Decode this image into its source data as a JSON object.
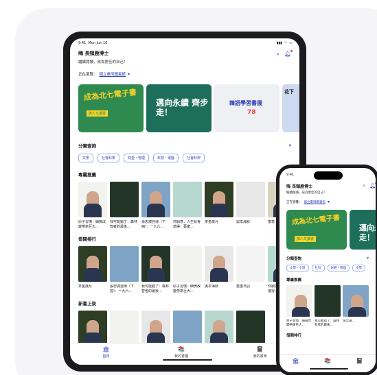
{
  "ipad": {
    "status": {
      "time": "9:41",
      "date": "Mon Jun 10"
    },
    "header": {
      "greeting": "嗨 長頸鹿博士",
      "subtitle": "繼續閱讀，成為更佳的自己！"
    },
    "browsing": {
      "label": "正在瀏覽：",
      "library": "國立臺灣圖書館"
    },
    "banners": [
      {
        "title": "成為北七電子書",
        "subtitle": "誰人又讀書",
        "color": "#2f8a50"
      },
      {
        "title": "邁向永續 齊步走！",
        "color": "#1d6f5c"
      },
      {
        "title": "韓語學習書展",
        "highlight": "78",
        "color": "#eef0f3"
      },
      {
        "title": "花下",
        "color": "#cdd9ee"
      }
    ],
    "categories": {
      "title": "分類查詢",
      "tags": [
        "文學",
        "社會科學",
        "財金・管理",
        "科技・電腦",
        "社會科學"
      ]
    },
    "recommended": {
      "title": "專屬推薦",
      "books": [
        {
          "title": "原子習慣：細微改變帶來巨大...",
          "cover_color": "#f2f2ee",
          "ink": "#333333"
        },
        {
          "title": "我可能錯了：森林智者的最後...",
          "cover_color": "#223526",
          "ink": "#e9dfb0"
        },
        {
          "title": "張忠謀自傳（下冊）：一九六...",
          "cover_color": "#7fa4c6",
          "ink": "#ffffff"
        },
        {
          "title": "你願意，人生就會值得：蔡康...",
          "cover_color": "#b7d8cf",
          "ink": "#2b4a44"
        },
        {
          "title": "茶金歲月",
          "cover_color": "#2d3e25",
          "ink": "#e5c65b"
        },
        {
          "title": "奧本海默",
          "cover_color": "#e7e7e7",
          "ink": "#333333"
        },
        {
          "title": "蜜笔",
          "cover_color": "#d8d2c0",
          "ink": "#333333"
        }
      ]
    },
    "ranking": {
      "title": "借閱排行",
      "books": [
        {
          "title": "茶金歲月",
          "cover_color": "#2d3e25",
          "ink": "#e5c65b"
        },
        {
          "title": "張忠謀自傳（下冊）：一九六...",
          "cover_color": "#7fa4c6",
          "ink": "#ffffff"
        },
        {
          "title": "我可能錯了：森林智者的最後...",
          "cover_color": "#223526",
          "ink": "#e9dfb0"
        },
        {
          "title": "原子習慣：細微改變帶來巨大...",
          "cover_color": "#f2f2ee",
          "ink": "#333333"
        },
        {
          "title": "奧本海默",
          "cover_color": "#e7e7e7",
          "ink": "#333333"
        },
        {
          "title": "蜜笛日記",
          "cover_color": "#f4f4f4",
          "ink": "#333333"
        },
        {
          "title": "你願意，人生就會值得：蔡康...",
          "cover_color": "#b7d8cf",
          "ink": "#2b4a44"
        }
      ]
    },
    "new_arrivals": {
      "title": "新書上架",
      "books": [
        {
          "title": "",
          "cover_color": "#2d3e25",
          "ink": "#e5c65b"
        },
        {
          "title": "",
          "cover_color": "#f2f2ee",
          "ink": "#333333"
        },
        {
          "title": "",
          "cover_color": "#e7e7e7",
          "ink": "#333333"
        },
        {
          "title": "",
          "cover_color": "#7fa4c6",
          "ink": "#ffffff"
        },
        {
          "title": "",
          "cover_color": "#b7d8cf",
          "ink": "#2b4a44"
        },
        {
          "title": "",
          "cover_color": "#223526",
          "ink": "#e9dfb0"
        }
      ]
    },
    "tabs": [
      {
        "label": "首頁",
        "icon": "home-icon",
        "glyph": "🏛",
        "active": true
      },
      {
        "label": "我的書櫃",
        "icon": "bookshelf-icon",
        "glyph": "📚",
        "active": false
      },
      {
        "label": "我的書單",
        "icon": "booklist-icon",
        "glyph": "📓",
        "active": false
      }
    ]
  },
  "iphone": {
    "status": {
      "time": "9:41"
    },
    "header": {
      "greeting": "嗨 長頸鹿博士",
      "subtitle": "繼續閱讀，成為更佳的自己！"
    },
    "browsing": {
      "label": "正在瀏覽：",
      "library": "國立臺灣圖書館"
    },
    "categories": {
      "title": "分類查詢",
      "tags": [
        "文學・小說",
        "社科",
        "財經・管理",
        "文學"
      ]
    },
    "recommended": {
      "title": "專屬推薦",
      "books": [
        {
          "title": "原子習慣：細微改變帶來巨大...",
          "cover_color": "#f2f2ee",
          "ink": "#333333"
        },
        {
          "title": "我可能錯了：森林智者的最後...",
          "cover_color": "#223526",
          "ink": "#e9dfb0"
        },
        {
          "title": "張忠謀...",
          "cover_color": "#7fa4c6",
          "ink": "#ffffff"
        }
      ]
    },
    "ranking_title": "借閱排行"
  },
  "colors": {
    "accent": "#2c3fb8",
    "device": "#1b1b1e"
  }
}
